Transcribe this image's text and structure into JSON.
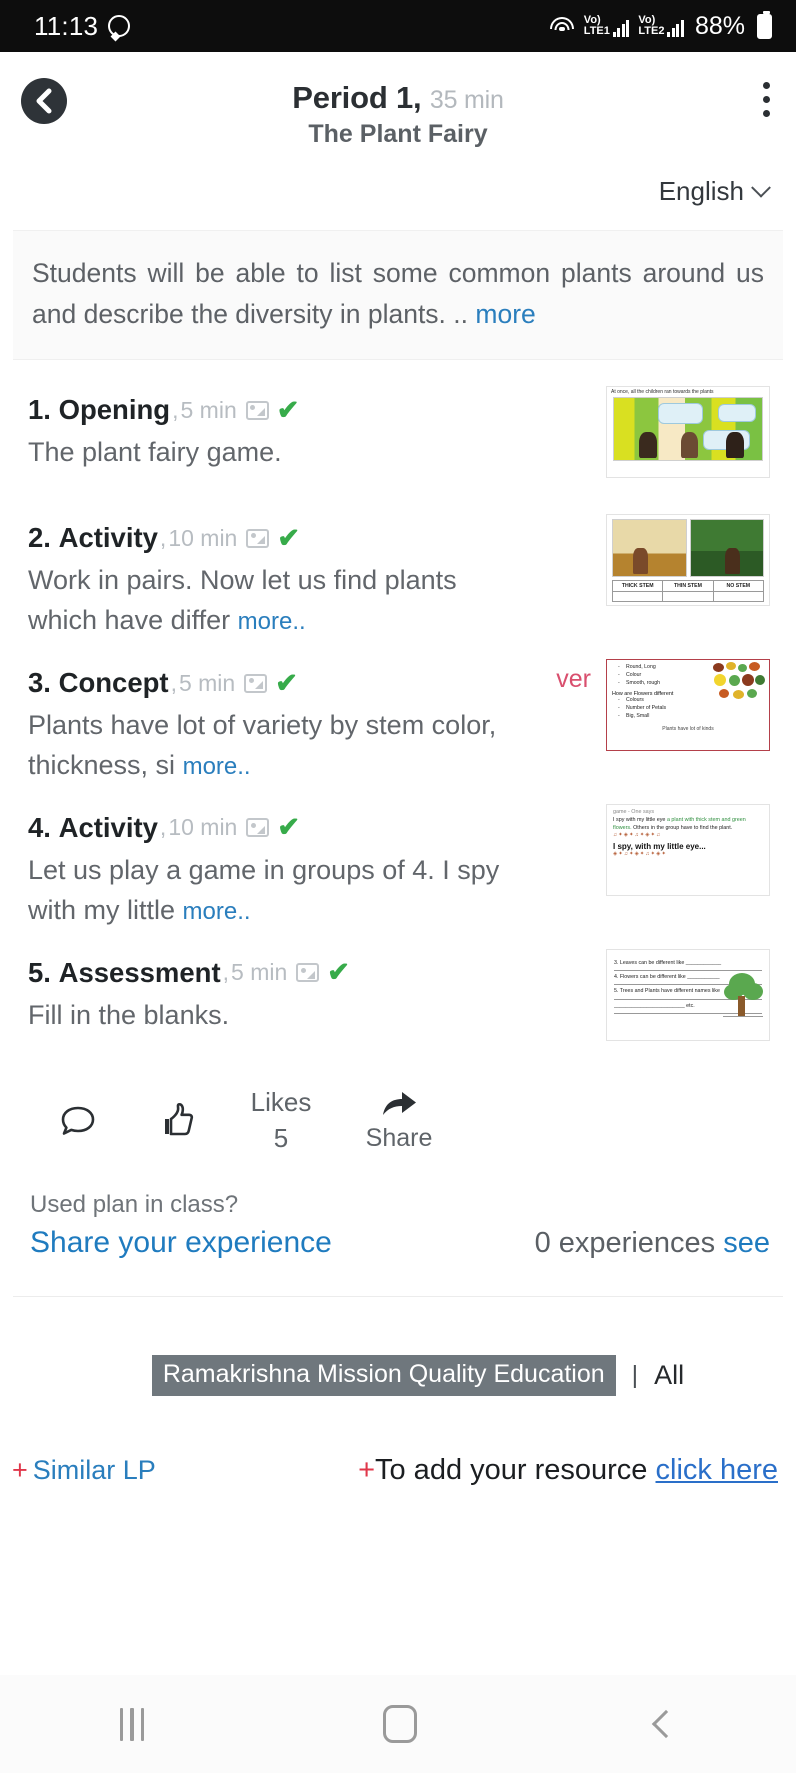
{
  "status_bar": {
    "time": "11:13",
    "whatsapp_icon": "whatsapp-icon",
    "wifi_icon": "wifi-icon",
    "sim1_label_top": "Vo)",
    "sim1_label_bottom": "LTE1",
    "sim2_label_top": "Vo)",
    "sim2_label_bottom": "LTE2",
    "battery_percent": "88%"
  },
  "header": {
    "back_icon": "back-arrow-icon",
    "title": "Period 1,",
    "duration": "35 min",
    "subtitle": "The Plant Fairy",
    "menu_icon": "kebab-menu-icon",
    "language": "English",
    "language_chevron": "chevron-down-icon"
  },
  "objective": {
    "text": "Students will be able to list some common plants around us and describe the diversity in plants. ..",
    "more_label": "more"
  },
  "steps": [
    {
      "number": "1.",
      "title": "Opening",
      "duration": "5 min",
      "image_icon": "image-icon",
      "check_icon": "green-check-icon",
      "body": "The plant fairy game.",
      "more_label": "",
      "thumb_caption": "At once, all the children ran towards the plants"
    },
    {
      "number": "2.",
      "title": "Activity",
      "duration": "10 min",
      "image_icon": "image-icon",
      "check_icon": "green-check-icon",
      "body": "Work in pairs. Now let us find plants which have differ",
      "more_label": "more..",
      "thumb_table": [
        "THICK STEM",
        "THIN STEM",
        "NO STEM"
      ]
    },
    {
      "number": "3.",
      "title": "Concept",
      "duration": "5 min",
      "image_icon": "image-icon",
      "check_icon": "green-check-icon",
      "body": "Plants have lot of variety by stem color, thickness, si",
      "more_label": "more..",
      "side_label": "ver",
      "thumb_list": [
        "Round, Long",
        "Colour",
        "Smooth, rough"
      ],
      "thumb_question": "How are Flowers different",
      "thumb_list2": [
        "Colours",
        "Number of Petals",
        "Big, Small"
      ],
      "thumb_footer": "Plants have lot of kinds"
    },
    {
      "number": "4.",
      "title": "Activity",
      "duration": "10 min",
      "image_icon": "image-icon",
      "check_icon": "green-check-icon",
      "body": "Let us play a game in groups of 4. I spy with my little",
      "more_label": "more..",
      "thumb_top": "game - One says",
      "thumb_text_a": "I spy with my little eye",
      "thumb_text_b": "a plant with thick stem and green flowers.",
      "thumb_text_c": "Others in the group have to find the plant.",
      "thumb_big": "I spy, with my little eye..."
    },
    {
      "number": "5.",
      "title": "Assessment",
      "duration": "5 min",
      "image_icon": "image-icon",
      "check_icon": "green-check-icon",
      "body": "Fill in the blanks.",
      "more_label": "",
      "thumb_lines": [
        "3. Leaves can be different like ____________",
        "4. Flowers can be different like ___________",
        "5. Trees and Plants have different names like"
      ],
      "thumb_line_last": "________________________ etc."
    }
  ],
  "actions": {
    "comment_icon": "comment-icon",
    "like_icon": "thumbs-up-icon",
    "likes_label": "Likes",
    "likes_count": "5",
    "share_icon": "share-arrow-icon",
    "share_label": "Share"
  },
  "experience": {
    "question": "Used plan in class?",
    "share_link": "Share your experience",
    "count_text": "0 experiences",
    "see_link": "see"
  },
  "tags": {
    "chip": "Ramakrishna Mission Quality Education",
    "separator": "|",
    "all": "All"
  },
  "bottom": {
    "similar_plus": "+",
    "similar_label": "Similar LP",
    "add_plus": "+",
    "add_text": "To add your resource",
    "add_link": "click here"
  },
  "navbar": {
    "recents_icon": "recents-icon",
    "home_icon": "home-icon",
    "back_icon": "back-icon"
  },
  "colors": {
    "accent_blue": "#2a7ebd",
    "check_green": "#37ab4a",
    "red_plus": "#e0374a",
    "pink_label": "#d94f6e",
    "tag_bg": "#6f777d"
  }
}
